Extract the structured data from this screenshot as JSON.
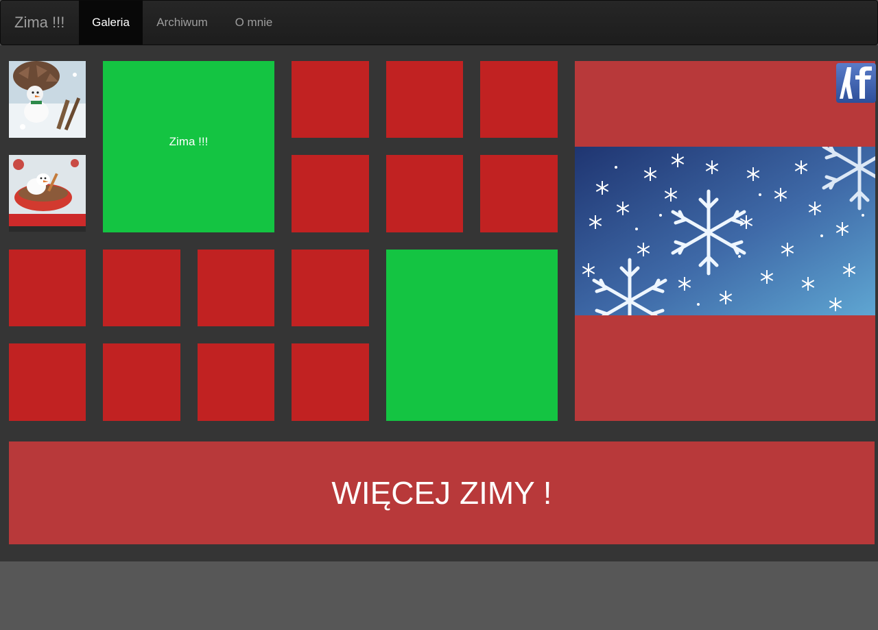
{
  "navbar": {
    "brand": "Zima !!!",
    "items": [
      {
        "label": "Galeria",
        "active": true
      },
      {
        "label": "Archiwum",
        "active": false
      },
      {
        "label": "O mnie",
        "active": false
      }
    ]
  },
  "gallery": {
    "green_tile_label": "Zima !!!",
    "thumbnails": [
      "snowman-pinecone-photo",
      "marshmallow-snowman-mug-photo"
    ],
    "featured_image": "snowflakes-photo",
    "logo_icon": "fb-logo-icon"
  },
  "banner": {
    "text": "WIĘCEJ ZIMY !"
  },
  "colors": {
    "tile_red": "#c12222",
    "tile_green": "#14c442",
    "panel_red": "#b8393a",
    "navbar": "#222222",
    "stage": "#353535",
    "page": "#575757"
  }
}
